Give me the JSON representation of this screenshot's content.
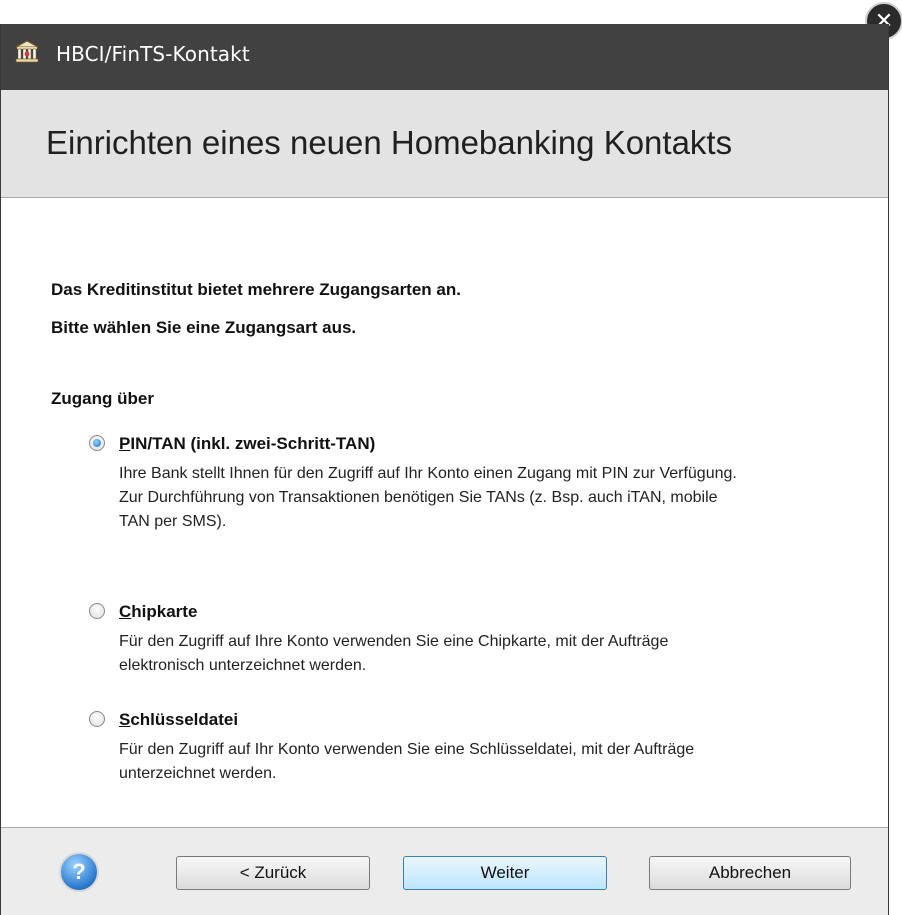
{
  "window": {
    "title": "HBCI/FinTS-Kontakt",
    "close_icon": "close-icon",
    "app_icon": "bank-icon"
  },
  "header": {
    "title": "Einrichten eines neuen Homebanking Kontakts"
  },
  "content": {
    "intro_line1": "Das Kreditinstitut bietet mehrere Zugangsarten an.",
    "intro_line2": "Bitte wählen Sie eine Zugangsart aus.",
    "group_label": "Zugang über",
    "options": [
      {
        "mnemonic": "P",
        "label_rest": "IN/TAN (inkl. zwei-Schritt-TAN)",
        "description": "Ihre Bank stellt Ihnen für den Zugriff auf Ihr Konto einen Zugang mit PIN zur Verfügung. Zur Durchführung von Transaktionen benötigen Sie TANs (z. Bsp. auch iTAN, mobile TAN per SMS).",
        "selected": true
      },
      {
        "mnemonic": "C",
        "label_rest": "hipkarte",
        "description": "Für den Zugriff auf Ihre Konto verwenden Sie eine Chipkarte, mit der Aufträge elektronisch unterzeichnet werden.",
        "selected": false
      },
      {
        "mnemonic": "S",
        "label_rest": "chlüsseldatei",
        "description": "Für den Zugriff auf Ihr Konto verwenden Sie eine Schlüsseldatei, mit der Aufträge unterzeichnet werden.",
        "selected": false
      }
    ]
  },
  "footer": {
    "help_icon": "help-icon",
    "back_label": "< Zurück",
    "next_label": "Weiter",
    "cancel_label": "Abbrechen"
  },
  "colors": {
    "titlebar": "#414141",
    "header_band": "#e3e3e3",
    "footer": "#ececec",
    "primary_button": "#bee6fd"
  }
}
